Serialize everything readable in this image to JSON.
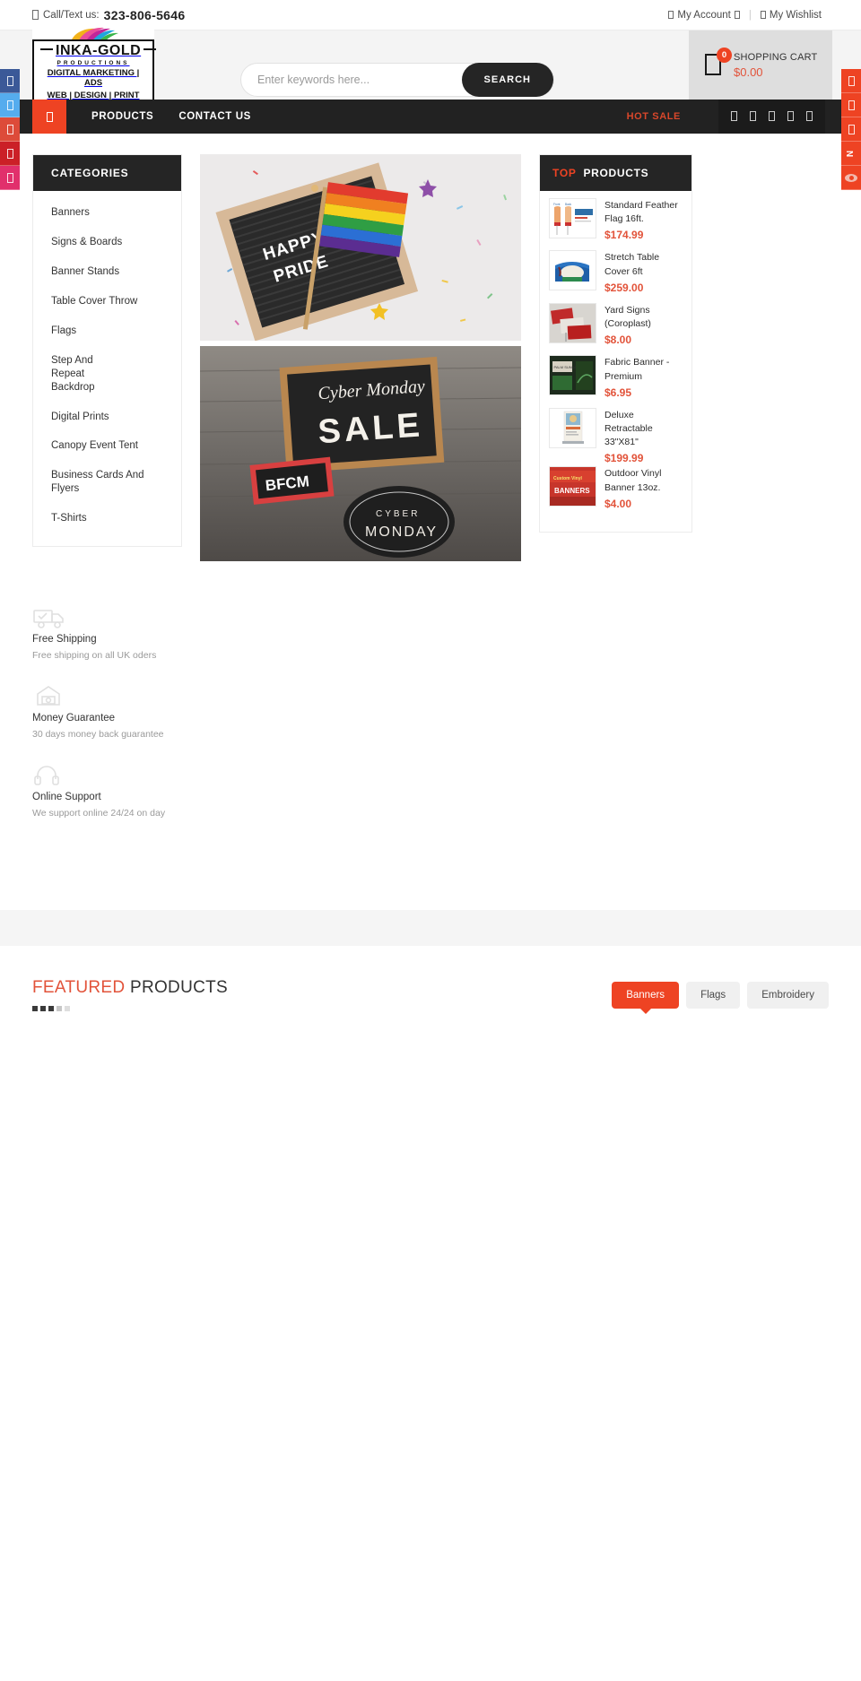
{
  "topbar": {
    "phone_icon": "phone-icon",
    "call_label": "Call/Text us:",
    "phone": "323-806-5646",
    "account_label": "My Account",
    "wishlist_label": "My Wishlist",
    "separator": "|"
  },
  "logo": {
    "name_left": "INKA",
    "name_right": "GOLD",
    "productions": "PRODUCTIONS",
    "tagline_line1": "DIGITAL MARKETING | ADS",
    "tagline_line2": "WEB | DESIGN | PRINT"
  },
  "search": {
    "placeholder": "Enter keywords here...",
    "value": "",
    "button_label": "SEARCH"
  },
  "cart": {
    "count": "0",
    "label": "SHOPPING CART",
    "total": "$0.00"
  },
  "nav": {
    "home_icon": "home-icon",
    "items": [
      {
        "label": "PRODUCTS"
      },
      {
        "label": "CONTACT US"
      }
    ],
    "hot_sale": "HOT SALE",
    "social_icons": [
      "facebook-icon",
      "twitter-icon",
      "google-plus-icon",
      "pinterest-icon",
      "instagram-icon"
    ]
  },
  "categories": {
    "heading": "CATEGORIES",
    "items": [
      {
        "label": "Banners"
      },
      {
        "label": "Signs & Boards"
      },
      {
        "label": "Banner Stands"
      },
      {
        "label": "Table Cover Throw"
      },
      {
        "label": "Flags"
      },
      {
        "label": "Step And Repeat Backdrop"
      },
      {
        "label": "Digital Prints"
      },
      {
        "label": "Canopy Event Tent"
      },
      {
        "label": "Business Cards And Flyers"
      },
      {
        "label": "T-Shirts"
      }
    ]
  },
  "hero": {
    "banner_top_alt": "Happy Pride letterboard with rainbow flag and confetti",
    "banner_top_text_line1": "HAPPY",
    "banner_top_text_line2": "PRIDE",
    "banner_bottom_alt": "Cyber Monday sale chalkboards on wood",
    "banner_bottom_text_script": "Cyber Monday",
    "banner_bottom_text_sale": "SALE",
    "banner_bottom_text_bfcm": "BFCM",
    "banner_bottom_text_cyber": "CYBER",
    "banner_bottom_text_monday": "MONDAY"
  },
  "top_products": {
    "heading_highlight": "TOP",
    "heading_rest": "PRODUCTS",
    "items": [
      {
        "name": "Standard Feather Flag 16ft.",
        "price": "$174.99",
        "thumb": "feather-flag-thumb"
      },
      {
        "name": "Stretch Table Cover 6ft",
        "price": "$259.00",
        "thumb": "table-cover-thumb"
      },
      {
        "name": "Yard Signs (Coroplast)",
        "price": "$8.00",
        "thumb": "yard-sign-thumb"
      },
      {
        "name": "Fabric Banner - Premium",
        "price": "$6.95",
        "thumb": "fabric-banner-thumb"
      },
      {
        "name": "Deluxe Retractable 33\"X81\"",
        "price": "$199.99",
        "thumb": "retractable-thumb"
      },
      {
        "name": "Outdoor Vinyl Banner 13oz.",
        "price": "$4.00",
        "thumb": "vinyl-banner-thumb"
      }
    ]
  },
  "services": [
    {
      "icon": "truck-icon",
      "title": "Free Shipping",
      "desc": "Free shipping on all UK oders"
    },
    {
      "icon": "money-icon",
      "title": "Money Guarantee",
      "desc": "30 days money back guarantee"
    },
    {
      "icon": "headset-icon",
      "title": "Online Support",
      "desc": "We support online 24/24 on day"
    }
  ],
  "featured": {
    "title_highlight": "FEATURED",
    "title_rest": "PRODUCTS",
    "tabs": [
      {
        "label": "Banners",
        "active": true
      },
      {
        "label": "Flags",
        "active": false
      },
      {
        "label": "Embroidery",
        "active": false
      }
    ]
  },
  "rails": {
    "left_icons": [
      "facebook-icon",
      "twitter-icon",
      "google-plus-icon",
      "pinterest-icon",
      "instagram-icon"
    ],
    "right_icons": [
      "share-icon",
      "cart-icon",
      "compare-icon",
      "new-label-icon",
      "preview-eye-icon"
    ],
    "right_new_label": "N"
  },
  "colors": {
    "accent": "#ee4323",
    "price": "#e2533a",
    "dark": "#252525",
    "facebook": "#3b5998",
    "twitter": "#55acee",
    "googleplus": "#dd4b39",
    "pinterest": "#cb2027",
    "instagram": "#e1306c"
  }
}
